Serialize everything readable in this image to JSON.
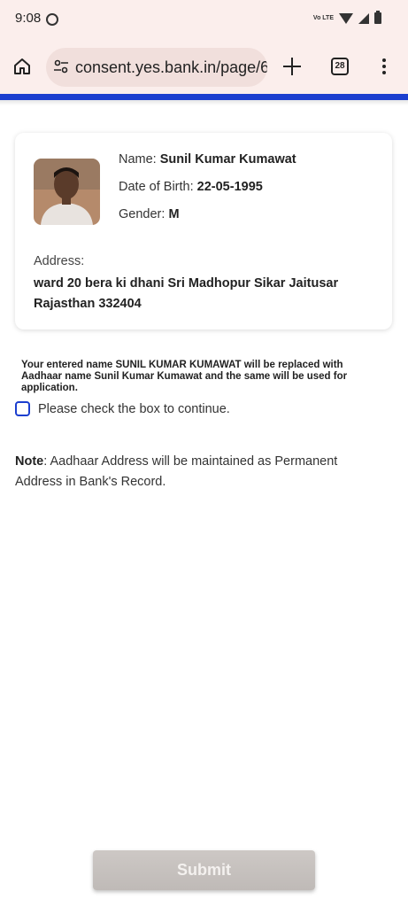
{
  "status_bar": {
    "time": "9:08",
    "network_label": "Vo LTE"
  },
  "browser": {
    "url": "consent.yes.bank.in/page/6",
    "tab_count": "28"
  },
  "card": {
    "name_label": "Name:",
    "name_value": "Sunil Kumar Kumawat",
    "dob_label": "Date of Birth:",
    "dob_value": "22-05-1995",
    "gender_label": "Gender:",
    "gender_value": "M",
    "address_label": "Address:",
    "address_value": "ward 20 bera ki dhani Sri Madhopur Sikar Jaitusar Rajasthan 332404"
  },
  "notice": "Your entered name SUNIL KUMAR KUMAWAT will be replaced with Aadhaar name Sunil Kumar Kumawat and the same will be used for application.",
  "consent": {
    "checked": false,
    "label": "Please check the box to continue."
  },
  "note": {
    "label": "Note",
    "text": ": Aadhaar Address will be maintained as Permanent Address in Bank's Record."
  },
  "submit": {
    "label": "Submit",
    "enabled": false
  },
  "colors": {
    "accent": "#1c3fcf",
    "browser_chrome": "#fbeeec",
    "submit_disabled": "#c6c1be"
  }
}
